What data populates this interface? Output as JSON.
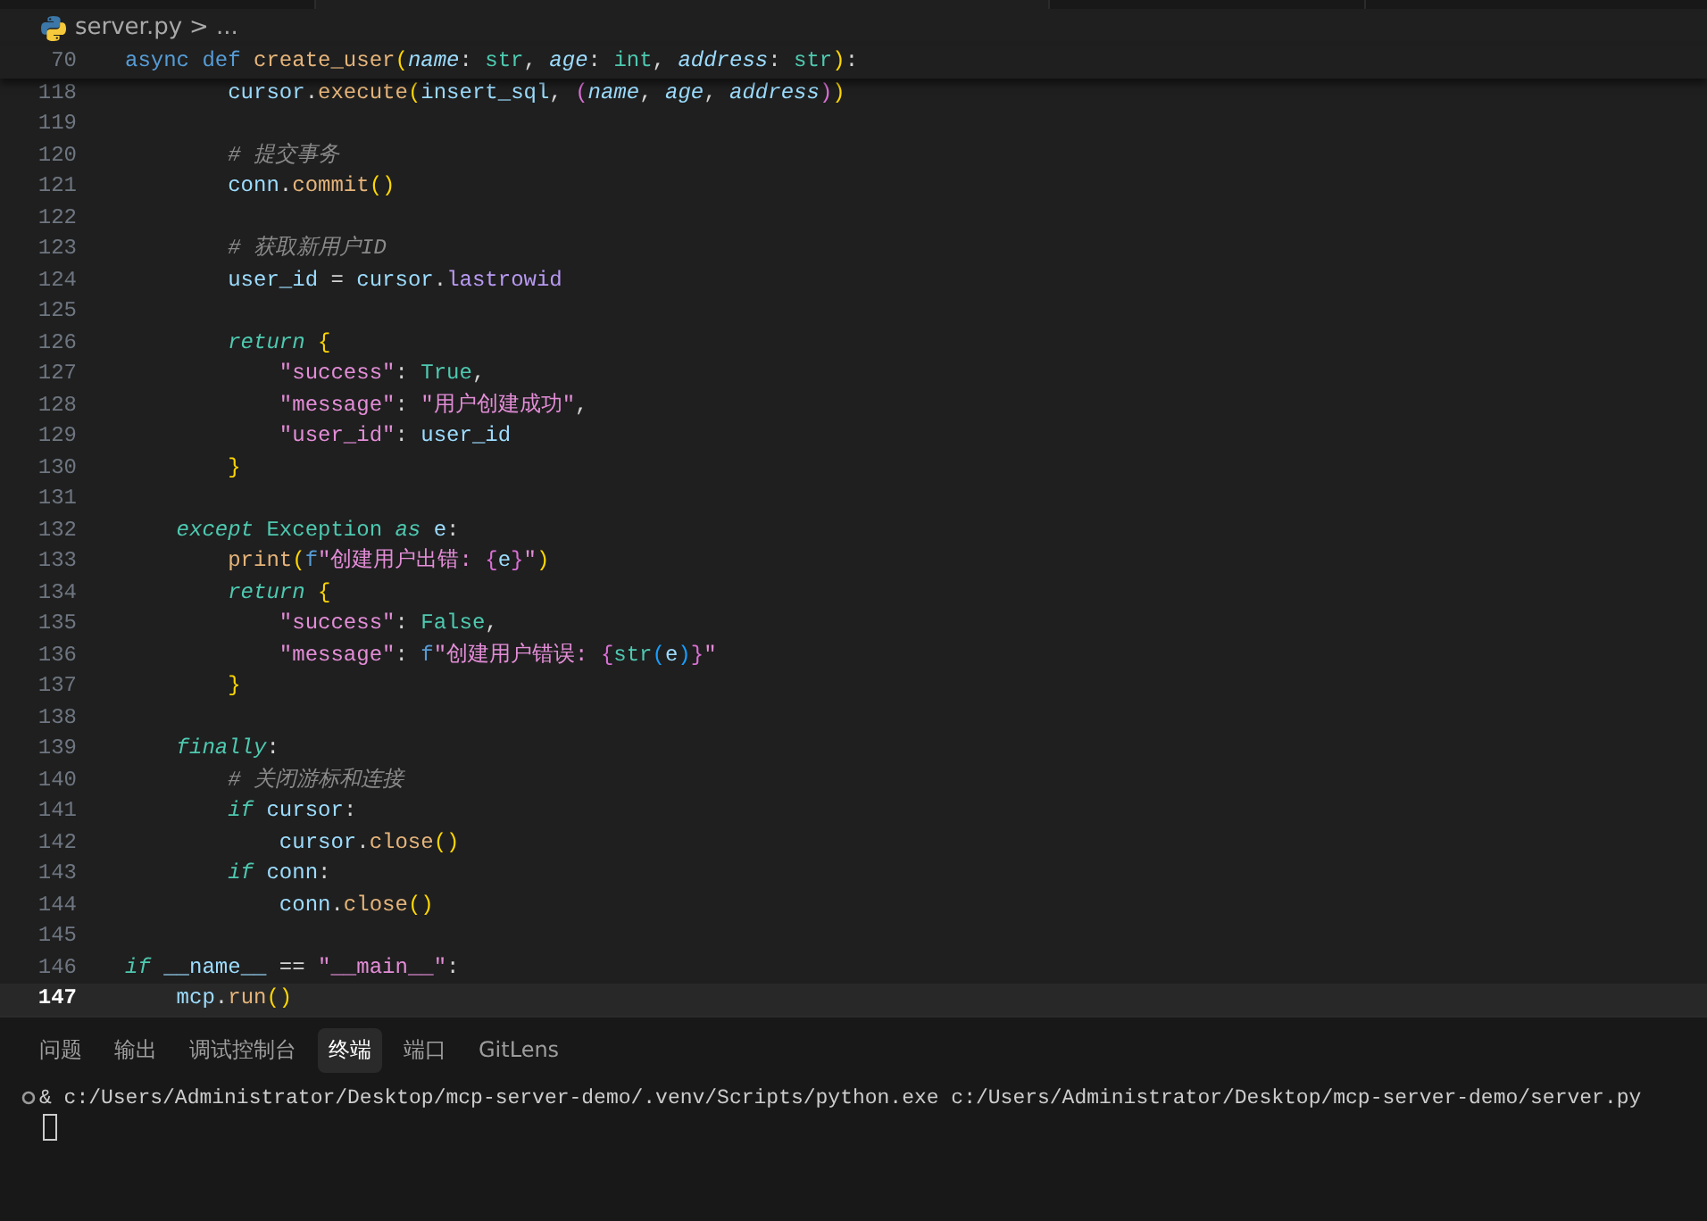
{
  "breadcrumb": {
    "file": "server.py",
    "separator": ">",
    "ellipsis": "..."
  },
  "sticky_line": {
    "number": "70",
    "tokens": [
      {
        "text": "async def ",
        "kind": "kw"
      },
      {
        "text": "create_user",
        "kind": "fn"
      },
      {
        "text": "(",
        "kind": "b1"
      },
      {
        "text": "name",
        "kind": "param"
      },
      {
        "text": ": ",
        "kind": "punct"
      },
      {
        "text": "str",
        "kind": "type"
      },
      {
        "text": ", ",
        "kind": "punct"
      },
      {
        "text": "age",
        "kind": "param"
      },
      {
        "text": ": ",
        "kind": "punct"
      },
      {
        "text": "int",
        "kind": "type"
      },
      {
        "text": ", ",
        "kind": "punct"
      },
      {
        "text": "address",
        "kind": "param"
      },
      {
        "text": ": ",
        "kind": "punct"
      },
      {
        "text": "str",
        "kind": "type"
      },
      {
        "text": ")",
        "kind": "b1"
      },
      {
        "text": ":",
        "kind": "punct"
      }
    ]
  },
  "lines": [
    {
      "number": "118",
      "current": false,
      "tokens": [
        {
          "text": "        cursor",
          "kind": "var"
        },
        {
          "text": ".",
          "kind": "punct"
        },
        {
          "text": "execute",
          "kind": "fn"
        },
        {
          "text": "(",
          "kind": "b1"
        },
        {
          "text": "insert_sql",
          "kind": "var"
        },
        {
          "text": ", ",
          "kind": "punct"
        },
        {
          "text": "(",
          "kind": "b2"
        },
        {
          "text": "name",
          "kind": "param"
        },
        {
          "text": ", ",
          "kind": "punct"
        },
        {
          "text": "age",
          "kind": "param"
        },
        {
          "text": ", ",
          "kind": "punct"
        },
        {
          "text": "address",
          "kind": "param"
        },
        {
          "text": ")",
          "kind": "b2"
        },
        {
          "text": ")",
          "kind": "b1"
        }
      ]
    },
    {
      "number": "119",
      "current": false
    },
    {
      "number": "120",
      "current": false,
      "tokens": [
        {
          "text": "        # 提交事务",
          "kind": "comment"
        }
      ]
    },
    {
      "number": "121",
      "current": false,
      "tokens": [
        {
          "text": "        conn",
          "kind": "var"
        },
        {
          "text": ".",
          "kind": "punct"
        },
        {
          "text": "commit",
          "kind": "fn"
        },
        {
          "text": "()",
          "kind": "b1"
        }
      ]
    },
    {
      "number": "122",
      "current": false
    },
    {
      "number": "123",
      "current": false,
      "tokens": [
        {
          "text": "        # 获取新用户ID",
          "kind": "comment"
        }
      ]
    },
    {
      "number": "124",
      "current": false,
      "tokens": [
        {
          "text": "        user_id",
          "kind": "var"
        },
        {
          "text": " = ",
          "kind": "punct"
        },
        {
          "text": "cursor",
          "kind": "var"
        },
        {
          "text": ".",
          "kind": "punct"
        },
        {
          "text": "lastrowid",
          "kind": "prop"
        }
      ]
    },
    {
      "number": "125",
      "current": false
    },
    {
      "number": "126",
      "current": false,
      "tokens": [
        {
          "text": "        return",
          "kind": "ctrl"
        },
        {
          "text": " {",
          "kind": "b1"
        }
      ]
    },
    {
      "number": "127",
      "current": false,
      "tokens": [
        {
          "text": "            \"success\"",
          "kind": "str"
        },
        {
          "text": ": ",
          "kind": "punct"
        },
        {
          "text": "True",
          "kind": "type"
        },
        {
          "text": ",",
          "kind": "punct"
        }
      ]
    },
    {
      "number": "128",
      "current": false,
      "tokens": [
        {
          "text": "            \"message\"",
          "kind": "str"
        },
        {
          "text": ": ",
          "kind": "punct"
        },
        {
          "text": "\"用户创建成功\"",
          "kind": "str"
        },
        {
          "text": ",",
          "kind": "punct"
        }
      ]
    },
    {
      "number": "129",
      "current": false,
      "tokens": [
        {
          "text": "            \"user_id\"",
          "kind": "str"
        },
        {
          "text": ": ",
          "kind": "punct"
        },
        {
          "text": "user_id",
          "kind": "var"
        }
      ]
    },
    {
      "number": "130",
      "current": false,
      "tokens": [
        {
          "text": "        }",
          "kind": "b1"
        }
      ]
    },
    {
      "number": "131",
      "current": false
    },
    {
      "number": "132",
      "current": false,
      "tokens": [
        {
          "text": "    except",
          "kind": "ctrl"
        },
        {
          "text": " Exception ",
          "kind": "type"
        },
        {
          "text": "as",
          "kind": "ctrl"
        },
        {
          "text": " e",
          "kind": "var"
        },
        {
          "text": ":",
          "kind": "punct"
        }
      ]
    },
    {
      "number": "133",
      "current": false,
      "tokens": [
        {
          "text": "        print",
          "kind": "fn"
        },
        {
          "text": "(",
          "kind": "b1"
        },
        {
          "text": "f",
          "kind": "kw"
        },
        {
          "text": "\"创建用户出错: ",
          "kind": "str"
        },
        {
          "text": "{",
          "kind": "b2"
        },
        {
          "text": "e",
          "kind": "var"
        },
        {
          "text": "}",
          "kind": "b2"
        },
        {
          "text": "\"",
          "kind": "str"
        },
        {
          "text": ")",
          "kind": "b1"
        }
      ]
    },
    {
      "number": "134",
      "current": false,
      "tokens": [
        {
          "text": "        return",
          "kind": "ctrl"
        },
        {
          "text": " {",
          "kind": "b1"
        }
      ]
    },
    {
      "number": "135",
      "current": false,
      "tokens": [
        {
          "text": "            \"success\"",
          "kind": "str"
        },
        {
          "text": ": ",
          "kind": "punct"
        },
        {
          "text": "False",
          "kind": "type"
        },
        {
          "text": ",",
          "kind": "punct"
        }
      ]
    },
    {
      "number": "136",
      "current": false,
      "tokens": [
        {
          "text": "            \"message\"",
          "kind": "str"
        },
        {
          "text": ": ",
          "kind": "punct"
        },
        {
          "text": "f",
          "kind": "kw"
        },
        {
          "text": "\"创建用户错误: ",
          "kind": "str"
        },
        {
          "text": "{",
          "kind": "b2"
        },
        {
          "text": "str",
          "kind": "type"
        },
        {
          "text": "(",
          "kind": "b3"
        },
        {
          "text": "e",
          "kind": "var"
        },
        {
          "text": ")",
          "kind": "b3"
        },
        {
          "text": "}",
          "kind": "b2"
        },
        {
          "text": "\"",
          "kind": "str"
        }
      ]
    },
    {
      "number": "137",
      "current": false,
      "tokens": [
        {
          "text": "        }",
          "kind": "b1"
        }
      ]
    },
    {
      "number": "138",
      "current": false
    },
    {
      "number": "139",
      "current": false,
      "tokens": [
        {
          "text": "    finally",
          "kind": "ctrl"
        },
        {
          "text": ":",
          "kind": "punct"
        }
      ]
    },
    {
      "number": "140",
      "current": false,
      "tokens": [
        {
          "text": "        # 关闭游标和连接",
          "kind": "comment"
        }
      ]
    },
    {
      "number": "141",
      "current": false,
      "tokens": [
        {
          "text": "        if",
          "kind": "ctrl"
        },
        {
          "text": " cursor",
          "kind": "var"
        },
        {
          "text": ":",
          "kind": "punct"
        }
      ]
    },
    {
      "number": "142",
      "current": false,
      "tokens": [
        {
          "text": "            cursor",
          "kind": "var"
        },
        {
          "text": ".",
          "kind": "punct"
        },
        {
          "text": "close",
          "kind": "fn"
        },
        {
          "text": "()",
          "kind": "b1"
        }
      ]
    },
    {
      "number": "143",
      "current": false,
      "tokens": [
        {
          "text": "        if",
          "kind": "ctrl"
        },
        {
          "text": " conn",
          "kind": "var"
        },
        {
          "text": ":",
          "kind": "punct"
        }
      ]
    },
    {
      "number": "144",
      "current": false,
      "tokens": [
        {
          "text": "            conn",
          "kind": "var"
        },
        {
          "text": ".",
          "kind": "punct"
        },
        {
          "text": "close",
          "kind": "fn"
        },
        {
          "text": "()",
          "kind": "b1"
        }
      ]
    },
    {
      "number": "145",
      "current": false
    },
    {
      "number": "146",
      "current": false,
      "tokens": [
        {
          "text": "if",
          "kind": "ctrl"
        },
        {
          "text": " __name__",
          "kind": "var"
        },
        {
          "text": " == ",
          "kind": "punct"
        },
        {
          "text": "\"__main__\"",
          "kind": "str"
        },
        {
          "text": ":",
          "kind": "punct"
        }
      ]
    },
    {
      "number": "147",
      "current": true,
      "tokens": [
        {
          "text": "    mcp",
          "kind": "var"
        },
        {
          "text": ".",
          "kind": "punct"
        },
        {
          "text": "run",
          "kind": "fn"
        },
        {
          "text": "()",
          "kind": "b1"
        }
      ]
    }
  ],
  "panel_tabs": [
    {
      "label": "问题",
      "selected": false
    },
    {
      "label": "输出",
      "selected": false
    },
    {
      "label": "调试控制台",
      "selected": false
    },
    {
      "label": "终端",
      "selected": true
    },
    {
      "label": "端口",
      "selected": false
    },
    {
      "label": "GitLens",
      "selected": false
    }
  ],
  "terminal": {
    "command": "& c:/Users/Administrator/Desktop/mcp-server-demo/.venv/Scripts/python.exe c:/Users/Administrator/Desktop/mcp-server-demo/server.py"
  }
}
